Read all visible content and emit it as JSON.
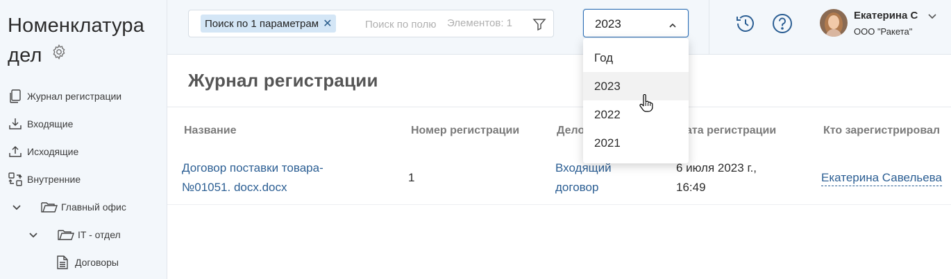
{
  "sidebar": {
    "title_line1": "Номенклатура",
    "title_line2": "дел",
    "items": [
      {
        "label": "Журнал регистрации",
        "icon": "copy-icon"
      },
      {
        "label": "Входящие",
        "icon": "inbox-download-icon"
      },
      {
        "label": "Исходящие",
        "icon": "outbox-upload-icon"
      },
      {
        "label": "Внутренние",
        "icon": "internal-swap-icon"
      },
      {
        "label": "Главный офис",
        "icon": "folder-icon"
      },
      {
        "label": "IT - отдел",
        "icon": "folder-icon"
      },
      {
        "label": "Договоры",
        "icon": "document-icon"
      }
    ]
  },
  "search": {
    "chip_label": "Поиск по 1 параметрам",
    "placeholder": "Поиск по полю",
    "count_text": "Элементов: 1"
  },
  "year_select": {
    "value": "2023",
    "options": [
      "Год",
      "2023",
      "2022",
      "2021"
    ],
    "hovered_option": "2023"
  },
  "user": {
    "name": "Екатерина С",
    "org": "ООО \"Ракета\""
  },
  "page": {
    "title": "Журнал регистрации"
  },
  "table": {
    "columns": [
      "Название",
      "Номер регистрации",
      "Дело",
      "Дата регистрации",
      "Кто зарегистрировал"
    ],
    "visible_headers": [
      "Название",
      "Номер регистрации",
      "Дело",
      "ата регистрации",
      "Кто зарегистрировал"
    ],
    "rows": [
      {
        "name_line1": "Договор поставки товара-",
        "name_line2": "№01051. docx.docx",
        "number": "1",
        "case_line1": "Входящий",
        "case_line2": "договор",
        "date_line1": "6 июля 2023 г.,",
        "date_line2": "16:49",
        "registered_by": "Екатерина Савельева"
      }
    ]
  },
  "colors": {
    "sidebar_bg": "#f3f7fb",
    "accent": "#2e6fb6",
    "link": "#2b5e93",
    "chip_bg": "#d4e6f6"
  }
}
